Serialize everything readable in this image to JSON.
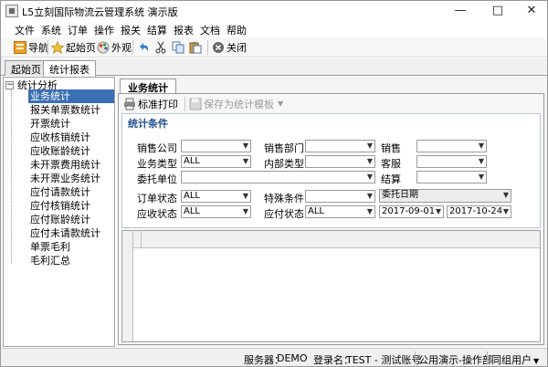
{
  "window": {
    "title": "L5立刻国际物流云管理系统 演示版",
    "minimize": "—",
    "maximize": "□",
    "close": "✕"
  },
  "menubar": [
    "文件",
    "系统",
    "订单",
    "操作",
    "报关",
    "结算",
    "报表",
    "文档",
    "帮助"
  ],
  "toolbar": {
    "nav": "导航",
    "home": "起始页",
    "appearance": "外观",
    "close": "关闭"
  },
  "doc_tabs": [
    "起始页",
    "统计报表"
  ],
  "sidebar": {
    "root": "统计分析",
    "items": [
      "业务统计",
      "报关单票数统计",
      "开票统计",
      "应收核销统计",
      "应收账龄统计",
      "未开票费用统计",
      "未开票业务统计",
      "应付请款统计",
      "应付核销统计",
      "应付账龄统计",
      "应付未请款统计",
      "单票毛利",
      "毛利汇总"
    ],
    "selected_index": 0
  },
  "content": {
    "tab": "业务统计",
    "print_button": "标准打印",
    "save_template_button": "保存为统计模板",
    "criteria_title": "统计条件",
    "fields": {
      "sales_company": {
        "label": "销售公司",
        "value": ""
      },
      "sales_dept": {
        "label": "销售部门",
        "value": ""
      },
      "salesperson": {
        "label": "销售",
        "value": ""
      },
      "business_type": {
        "label": "业务类型",
        "value": "ALL"
      },
      "internal_type": {
        "label": "内部类型",
        "value": ""
      },
      "customer_service": {
        "label": "客服",
        "value": ""
      },
      "client": {
        "label": "委托单位",
        "value": ""
      },
      "settlement": {
        "label": "结算",
        "value": ""
      },
      "order_status": {
        "label": "订单状态",
        "value": "ALL"
      },
      "special_condition": {
        "label": "特殊条件",
        "value": ""
      },
      "date_type": {
        "value": "委托日期"
      },
      "receivable_status": {
        "label": "应收状态",
        "value": "ALL"
      },
      "payable_status": {
        "label": "应付状态",
        "value": "ALL"
      },
      "date_from": {
        "value": "2017-09-01"
      },
      "date_to": {
        "value": "2017-10-24"
      }
    }
  },
  "statusbar": {
    "server_label": "服务器：",
    "server_value": "DEMO",
    "login_label": "登录名：",
    "login_value": "TEST - 测试账号",
    "company": "公用演示-操作部",
    "user_button": "同组用户"
  },
  "colors": {
    "selection": "#3a6fb4",
    "criteria_title": "#1f4e8c",
    "nav_icon": "#f0a020"
  }
}
